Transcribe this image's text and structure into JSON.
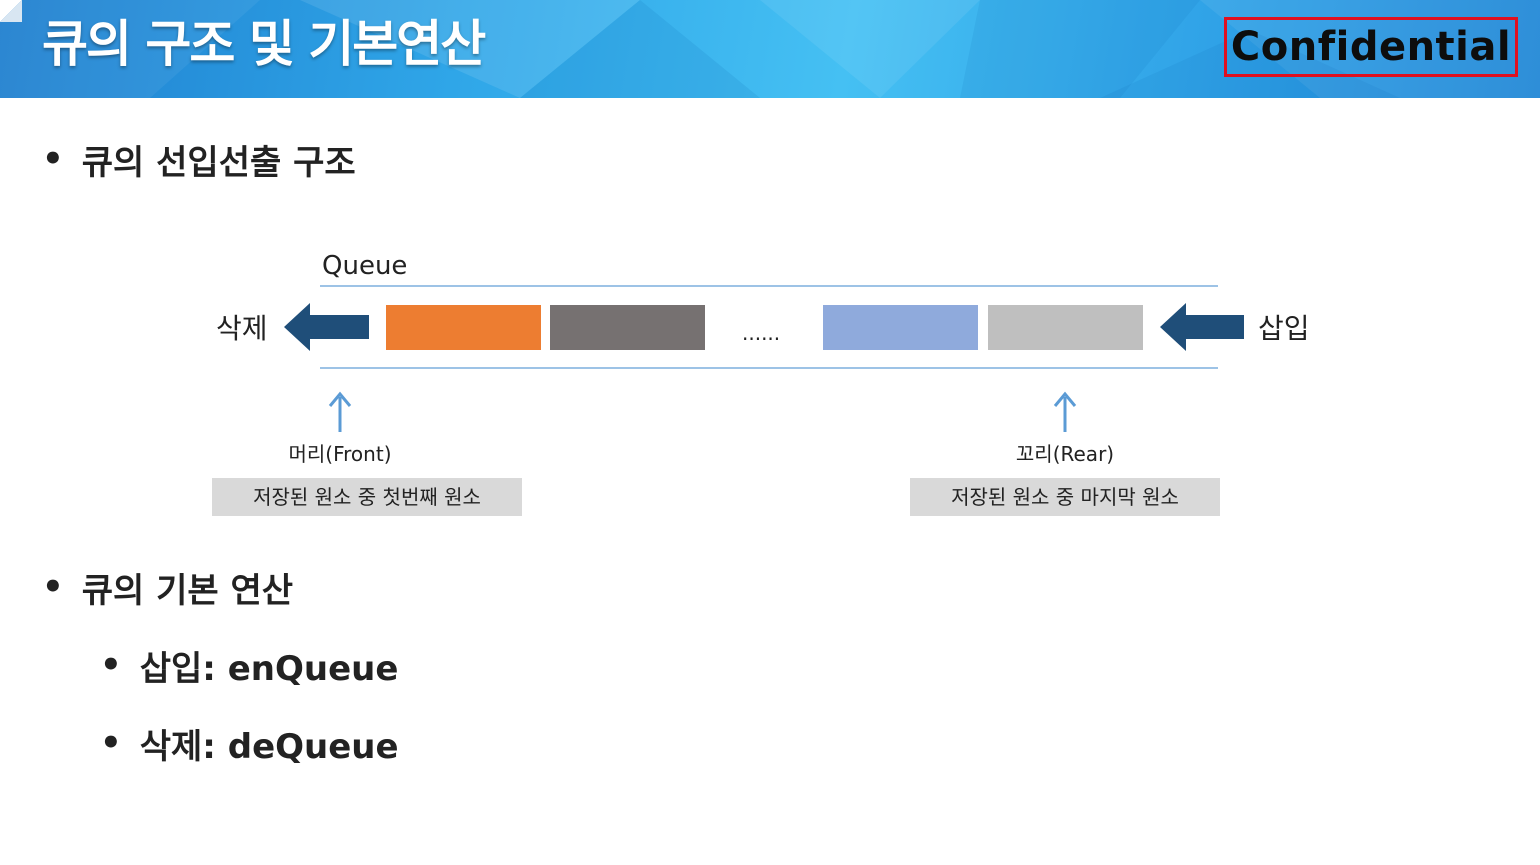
{
  "header": {
    "title": "큐의 구조 및 기본연산",
    "confidential": "Confidential"
  },
  "bullets": {
    "b1": "큐의 선입선출 구조",
    "b2": "큐의 기본 연산",
    "b3": "삽입: enQueue",
    "b4": "삭제: deQueue"
  },
  "diagram": {
    "queue_label": "Queue",
    "delete_label": "삭제",
    "insert_label": "삽입",
    "ellipsis": "......",
    "front_label": "머리(Front)",
    "rear_label": "꼬리(Rear)",
    "front_desc": "저장된 원소 중 첫번째 원소",
    "rear_desc": "저장된 원소 중 마지막 원소",
    "colors": {
      "block1": "#ed7d31",
      "block2": "#767171",
      "block3": "#8faadc",
      "block4": "#bfbfbf",
      "arrow": "#1f4e79",
      "pointer": "#5b9bd5",
      "rail": "#9dc3e6",
      "desc_bg": "#d9d9d9"
    }
  }
}
